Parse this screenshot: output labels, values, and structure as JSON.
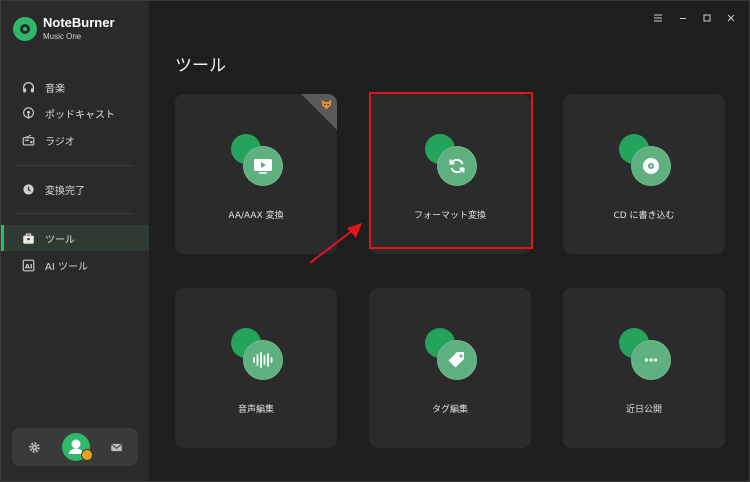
{
  "app": {
    "name": "NoteBurner",
    "subtitle": "Music One"
  },
  "sidebar": {
    "items": [
      {
        "label": "音楽",
        "icon": "headphones-icon"
      },
      {
        "label": "ポッドキャスト",
        "icon": "podcast-icon"
      },
      {
        "label": "ラジオ",
        "icon": "radio-icon"
      },
      {
        "label": "変換完了",
        "icon": "clock-icon"
      },
      {
        "label": "ツール",
        "icon": "toolbox-icon",
        "active": true
      },
      {
        "label": "AI ツール",
        "icon": "ai-icon"
      }
    ]
  },
  "window_controls": [
    "menu-icon",
    "minimize-icon",
    "maximize-icon",
    "close-icon"
  ],
  "main": {
    "title": "ツール",
    "tools": [
      {
        "label": "AA/AAX 変換",
        "icon": "video-play-icon"
      },
      {
        "label": "フォーマット変換",
        "icon": "refresh-icon",
        "highlighted": true
      },
      {
        "label": "CD に書き込む",
        "icon": "disc-icon"
      },
      {
        "label": "音声編集",
        "icon": "waveform-icon"
      },
      {
        "label": "タグ編集",
        "icon": "tag-icon"
      },
      {
        "label": "近日公開",
        "icon": "more-icon"
      }
    ]
  },
  "colors": {
    "accent": "#2fb86a",
    "highlight": "#e0161c",
    "background": "#1e1e1e",
    "sidebar": "#2a2a2a",
    "card": "#2b2b2b"
  }
}
